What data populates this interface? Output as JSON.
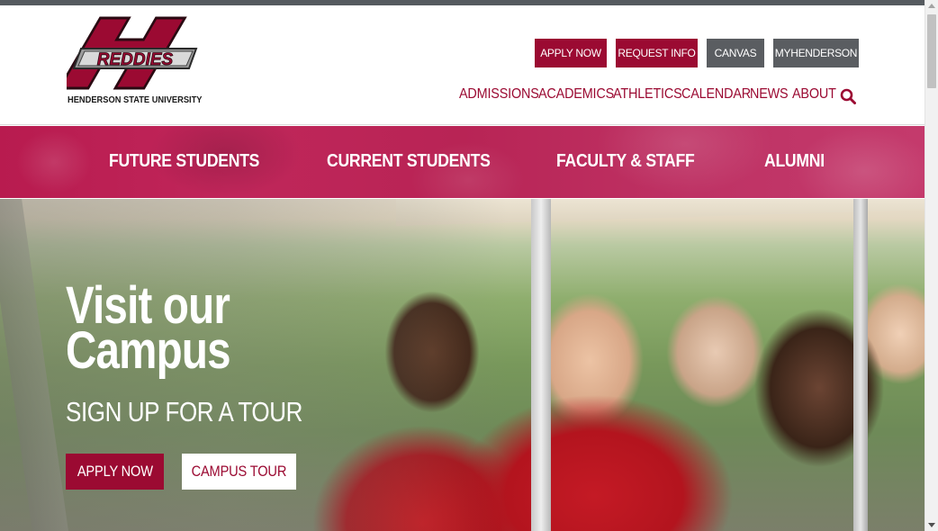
{
  "logo": {
    "wordmark": "REDDIES",
    "subtitle": "HENDERSON STATE UNIVERSITY"
  },
  "utility_nav": {
    "apply": "APPLY NOW",
    "request": "REQUEST INFO",
    "canvas": "CANVAS",
    "myhenderson": "MYHENDERSON"
  },
  "main_nav": {
    "items": [
      "ADMISSIONS",
      "ACADEMICS",
      "ATHLETICS",
      "CALENDAR",
      "NEWS",
      "ABOUT"
    ]
  },
  "audience_nav": {
    "items": [
      "FUTURE STUDENTS",
      "CURRENT STUDENTS",
      "FACULTY & STAFF",
      "ALUMNI"
    ]
  },
  "hero": {
    "title_line1": "Visit our",
    "title_line2": "Campus",
    "subtitle": "SIGN UP FOR A TOUR",
    "primary_button": "APPLY NOW",
    "secondary_button": "CAMPUS TOUR"
  },
  "colors": {
    "brand_red": "#9b0a32",
    "utility_gray": "#5a5d61",
    "audience_bar": "#b81b4f"
  },
  "icons": {
    "search": "search-icon"
  }
}
